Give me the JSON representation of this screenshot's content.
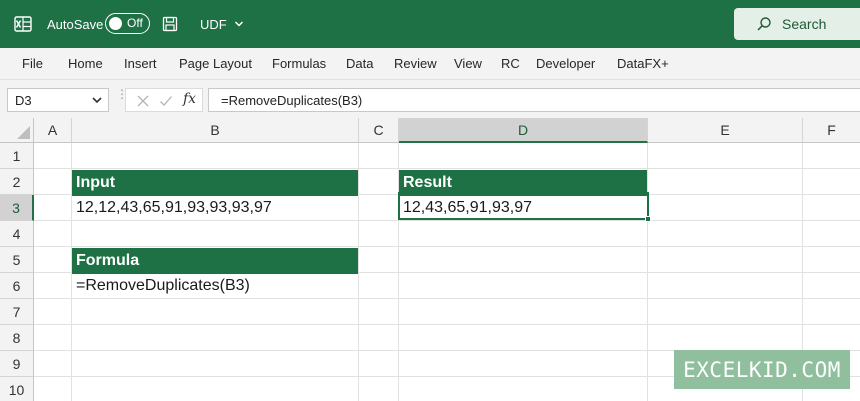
{
  "titlebar": {
    "autosave_label": "AutoSave",
    "autosave_state": "Off",
    "filename": "UDF",
    "search_label": "Search"
  },
  "ribbon": {
    "tabs": [
      "File",
      "Home",
      "Insert",
      "Page Layout",
      "Formulas",
      "Data",
      "Review",
      "View",
      "RC",
      "Developer",
      "DataFX+"
    ]
  },
  "formula_bar": {
    "name_box": "D3",
    "formula": "=RemoveDuplicates(B3)",
    "fx_label": "fx"
  },
  "grid": {
    "columns": [
      "A",
      "B",
      "C",
      "D",
      "E",
      "F"
    ],
    "rows": [
      "1",
      "2",
      "3",
      "4",
      "5",
      "6",
      "7",
      "8",
      "9",
      "10"
    ],
    "cells": {
      "B2": "Input",
      "B3": "12,12,43,65,91,93,93,93,97",
      "B5": "Formula",
      "B6": "=RemoveDuplicates(B3)",
      "D2": "Result",
      "D3": "12,43,65,91,93,97"
    }
  },
  "watermark": "EXCELKID.COM",
  "colors": {
    "accent": "#1e7145",
    "header_fill": "#1e7145",
    "watermark": "#8fbf9d"
  }
}
